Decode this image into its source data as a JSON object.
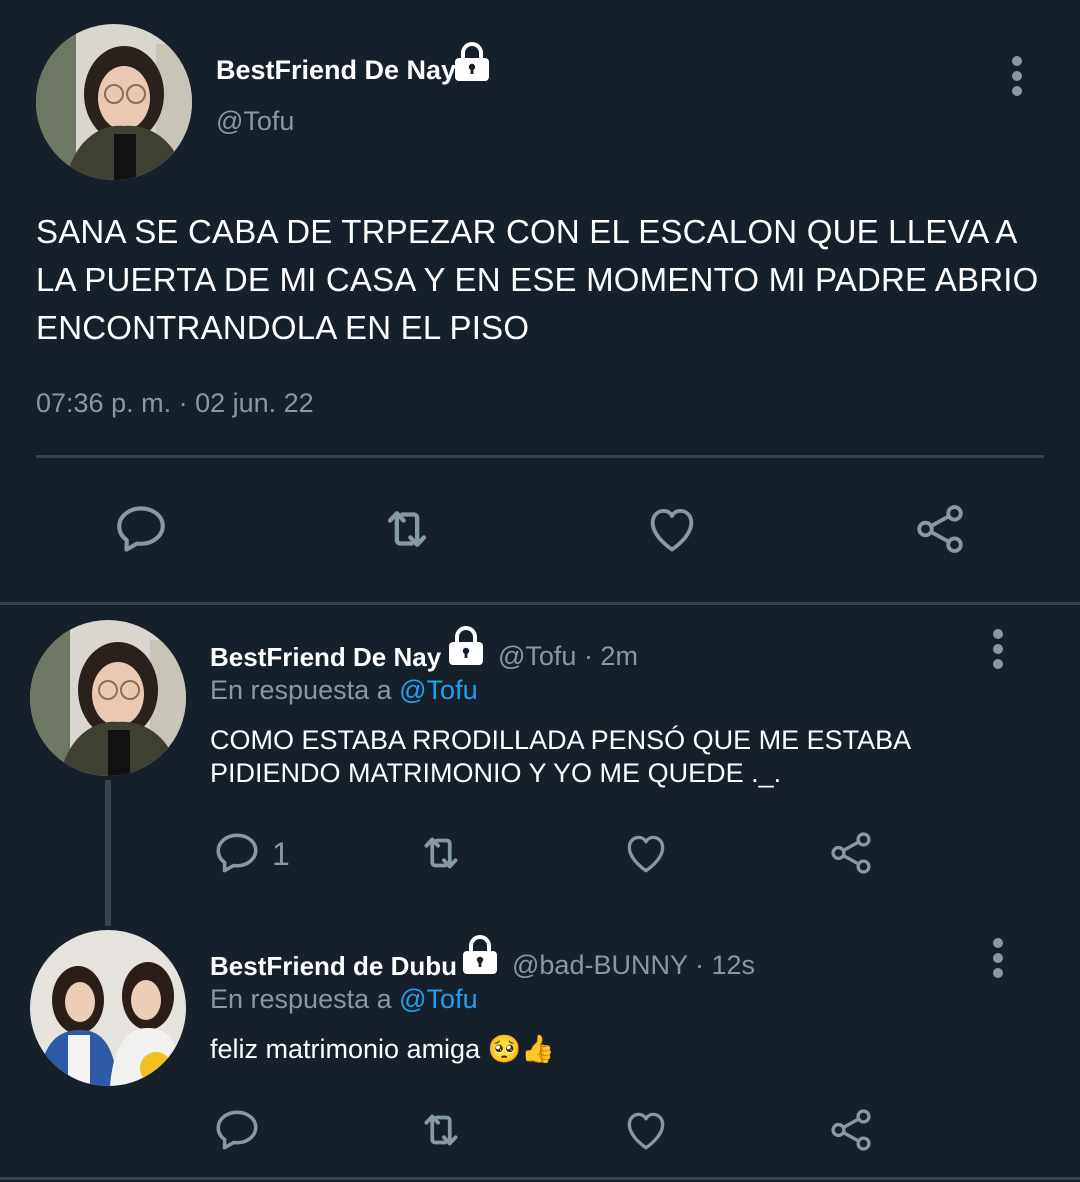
{
  "main_tweet": {
    "display_name": "BestFriend De Nay",
    "handle": "@Tofu",
    "text": "SANA SE CABA DE TRPEZAR CON EL ESCALON QUE LLEVA A LA PUERTA DE MI CASA Y EN ESE MOMENTO MI PADRE ABRIO ENCONTRANDOLA EN EL PISO",
    "timestamp": "07:36 p. m. · 02 jun. 22"
  },
  "replies": [
    {
      "display_name": "BestFriend De Nay",
      "meta": "@Tofu · 2m",
      "reply_prefix": "En respuesta a",
      "reply_to": "@Tofu",
      "text": "COMO ESTABA RRODILLADA PENSÓ QUE ME ESTABA PIDIENDO MATRIMONIO Y YO ME QUEDE ._.",
      "reply_count": "1"
    },
    {
      "display_name": "BestFriend de Dubu",
      "meta": "@bad-BUNNY · 12s",
      "reply_prefix": "En respuesta a",
      "reply_to": "@Tofu",
      "text": "feliz matrimonio amiga",
      "emojis": "🥺👍"
    }
  ],
  "icons": [
    "lock-icon",
    "more-icon",
    "reply-icon",
    "retweet-icon",
    "like-icon",
    "share-icon"
  ],
  "colors": {
    "background": "#15202b",
    "text": "#ffffff",
    "muted": "#8899a6",
    "link": "#1da1f2",
    "divider": "#38444d"
  }
}
